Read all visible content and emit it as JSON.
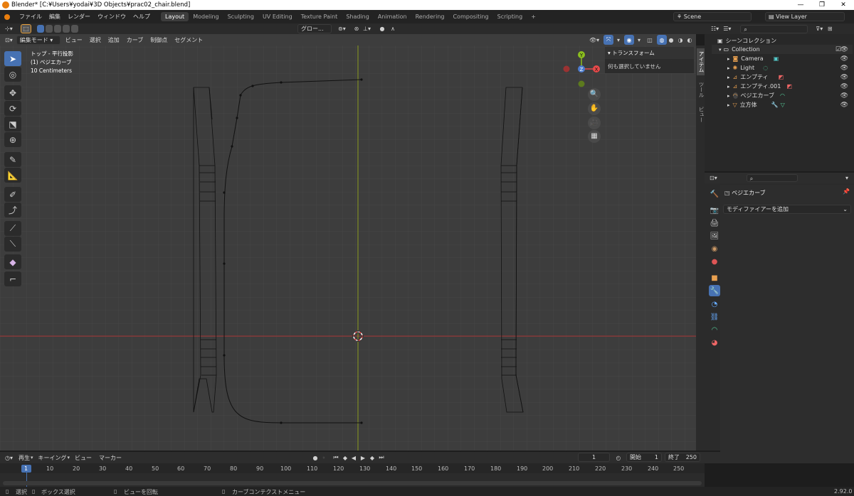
{
  "window": {
    "title": "Blender* [C:¥Users¥yodai¥3D Objects¥prac02_chair.blend]",
    "version": "2.92.0"
  },
  "menubar": {
    "items": [
      "ファイル",
      "編集",
      "レンダー",
      "ウィンドウ",
      "ヘルプ"
    ],
    "workspaces": [
      "Layout",
      "Modeling",
      "Sculpting",
      "UV Editing",
      "Texture Paint",
      "Shading",
      "Animation",
      "Rendering",
      "Compositing",
      "Scripting"
    ],
    "active_workspace": "Layout",
    "add_tab": "+",
    "scene": "Scene",
    "view_layer": "View Layer"
  },
  "viewport": {
    "header": {
      "mode": "編集モード",
      "menus": [
        "ビュー",
        "選択",
        "追加",
        "カーブ",
        "制御点",
        "セグメント"
      ],
      "orientation": "グロー..."
    },
    "overlay_text": [
      "トップ - 平行投影",
      "(1) ベジエカーブ",
      "10 Centimeters"
    ],
    "gizmo": {
      "y": "Y",
      "z": "Z",
      "x": "X"
    },
    "npanel": {
      "section": "トランスフォーム",
      "message": "何も選択していません",
      "tabs": [
        "アイテム",
        "ツール",
        "ビュー"
      ]
    },
    "colors": {
      "bg": "#3d3d3d",
      "x_axis": "#a83232",
      "y_axis": "#8c9c20",
      "selected": "#4772b3"
    }
  },
  "outliner": {
    "search_placeholder": "",
    "root": "シーンコレクション",
    "collection": "Collection",
    "items": [
      {
        "name": "Camera",
        "icon": "camera-icon"
      },
      {
        "name": "Light",
        "icon": "light-icon"
      },
      {
        "name": "エンプティ",
        "icon": "empty-icon"
      },
      {
        "name": "エンプティ.001",
        "icon": "empty-icon"
      },
      {
        "name": "ベジエカーブ",
        "icon": "curve-icon"
      },
      {
        "name": "立方体",
        "icon": "mesh-icon"
      }
    ]
  },
  "properties": {
    "object_name": "ベジエカーブ",
    "add_modifier": "モディファイアーを追加"
  },
  "timeline": {
    "menus": [
      "再生",
      "キーイング",
      "ビュー",
      "マーカー"
    ],
    "current_frame": "1",
    "start_label": "開始",
    "start": "1",
    "end_label": "終了",
    "end": "250",
    "ticks": [
      "1",
      "10",
      "20",
      "30",
      "40",
      "50",
      "60",
      "70",
      "80",
      "90",
      "100",
      "110",
      "120",
      "130",
      "140",
      "150",
      "160",
      "170",
      "180",
      "190",
      "200",
      "210",
      "220",
      "230",
      "240",
      "250"
    ]
  },
  "statusbar": {
    "select": "選択",
    "box_select": "ボックス選択",
    "rotate_view": "ビューを回転",
    "context_menu": "カーブコンテクストメニュー"
  }
}
